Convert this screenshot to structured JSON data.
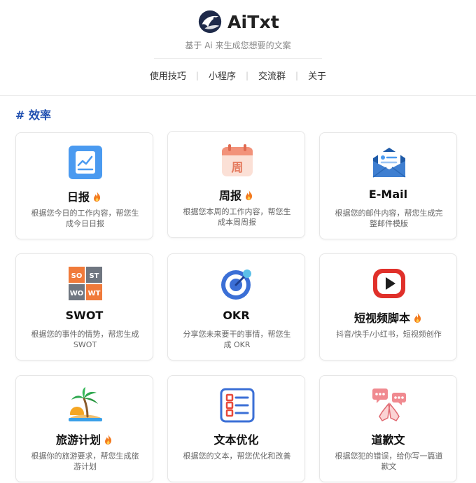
{
  "brand": {
    "name": "AiTxt",
    "tagline": "基于 Ai 来生成您想要的文案"
  },
  "nav": [
    {
      "label": "使用技巧"
    },
    {
      "label": "小程序"
    },
    {
      "label": "交流群"
    },
    {
      "label": "关于"
    }
  ],
  "section": {
    "title": "# 效率"
  },
  "cards": [
    {
      "title": "日报",
      "desc": "根据您今日的工作内容，帮您生成今日日报",
      "icon": "daily-report-icon",
      "hot": true
    },
    {
      "title": "周报",
      "desc": "根据您本周的工作内容，帮您生成本周周报",
      "icon": "calendar-week-icon",
      "hot": true,
      "badge": "周"
    },
    {
      "title": "E-Mail",
      "desc": "根据您的邮件内容，帮您生成完整邮件模版",
      "icon": "envelope-icon",
      "hot": false
    },
    {
      "title": "SWOT",
      "desc": "根据您的事件的情势，帮您生成 SWOT",
      "icon": "swot-grid-icon",
      "hot": false,
      "swot": [
        "SO",
        "ST",
        "WO",
        "WT"
      ]
    },
    {
      "title": "OKR",
      "desc": "分享您未来要干的事情，帮您生成 OKR",
      "icon": "target-icon",
      "hot": false
    },
    {
      "title": "短视频脚本",
      "desc": "抖音/快手/小红书，短视频创作",
      "icon": "video-play-icon",
      "hot": true
    },
    {
      "title": "旅游计划",
      "desc": "根据你的旅游要求，帮您生成旅游计划",
      "icon": "palm-island-icon",
      "hot": true
    },
    {
      "title": "文本优化",
      "desc": "根据您的文本，帮您优化和改善",
      "icon": "list-document-icon",
      "hot": false
    },
    {
      "title": "道歉文",
      "desc": "根据您犯的错误，给你写一篇道歉文",
      "icon": "apology-hands-icon",
      "hot": false
    }
  ],
  "colors": {
    "accent": "#1f4fb0",
    "fire": "#f37a1f"
  }
}
